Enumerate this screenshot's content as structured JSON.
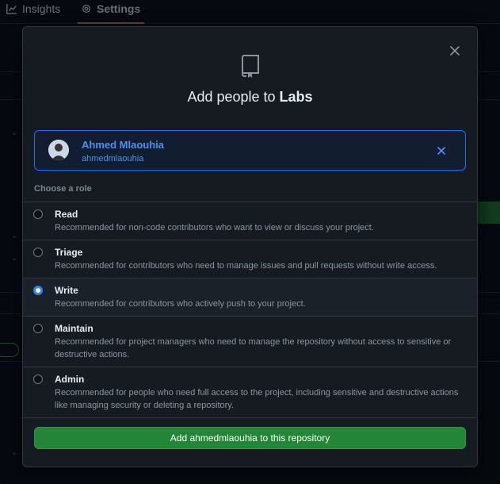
{
  "background": {
    "tabs": [
      {
        "label": "Insights",
        "icon": "graph-icon"
      },
      {
        "label": "Settings",
        "icon": "gear-icon"
      }
    ]
  },
  "modal": {
    "title_prefix": "Add people to ",
    "title_repo": "Labs",
    "selected_user": {
      "name": "Ahmed Mlaouhia",
      "login": "ahmedmlaouhia"
    },
    "role_heading": "Choose a role",
    "roles": [
      {
        "name": "Read",
        "description": "Recommended for non-code contributors who want to view or discuss your project.",
        "selected": false
      },
      {
        "name": "Triage",
        "description": "Recommended for contributors who need to manage issues and pull requests without write access.",
        "selected": false
      },
      {
        "name": "Write",
        "description": "Recommended for contributors who actively push to your project.",
        "selected": true
      },
      {
        "name": "Maintain",
        "description": "Recommended for project managers who need to manage the repository without access to sensitive or destructive actions.",
        "selected": false
      },
      {
        "name": "Admin",
        "description": "Recommended for people who need full access to the project, including sensitive and destructive actions like managing security or deleting a repository.",
        "selected": false
      }
    ],
    "submit_label": "Add ahmedmlaouhia to this repository"
  },
  "colors": {
    "accent": "#2f81f7",
    "primary_button": "#238636",
    "link": "#4493f8"
  }
}
